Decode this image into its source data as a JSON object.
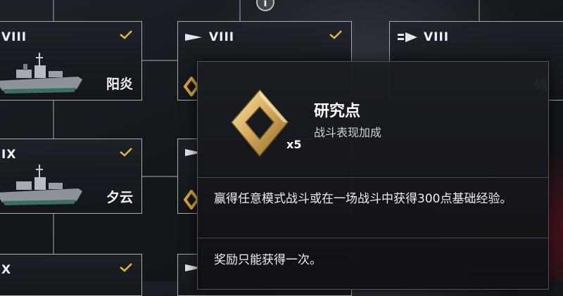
{
  "info_button": {
    "label": "i",
    "icon": "info-icon"
  },
  "ship_nodes": [
    {
      "tier": "VIII",
      "name": "阳炎",
      "researched": true,
      "icon": "destroyer-ship-icon"
    },
    {
      "tier": "IX",
      "name": "夕云",
      "researched": true,
      "icon": "destroyer-ship-icon"
    },
    {
      "tier": "X",
      "name": "",
      "researched": true,
      "icon": "destroyer-ship-icon"
    }
  ],
  "middle_nodes": [
    {
      "tier": "VIII",
      "class_icon": "destroyer-class-icon",
      "researched": true
    },
    {
      "tier": "",
      "class_icon": "destroyer-class-icon"
    },
    {
      "tier": "",
      "class_icon": "destroyer-class-icon"
    }
  ],
  "right_node": {
    "tier": "VIII",
    "class_icon": "premium-destroyer-class-icon",
    "name_partial": "鸠"
  },
  "tooltip": {
    "icon": "research-points-icon",
    "multiplier": "x5",
    "title": "研究点",
    "subtitle": "战斗表现加成",
    "description": "赢得任意模式战斗或在一场战斗中获得300点基础经验。",
    "note": "奖励只能获得一次。"
  },
  "colors": {
    "accent_gold": "#e2b640",
    "panel_bg": "#15181d",
    "border": "#d7dce2"
  }
}
